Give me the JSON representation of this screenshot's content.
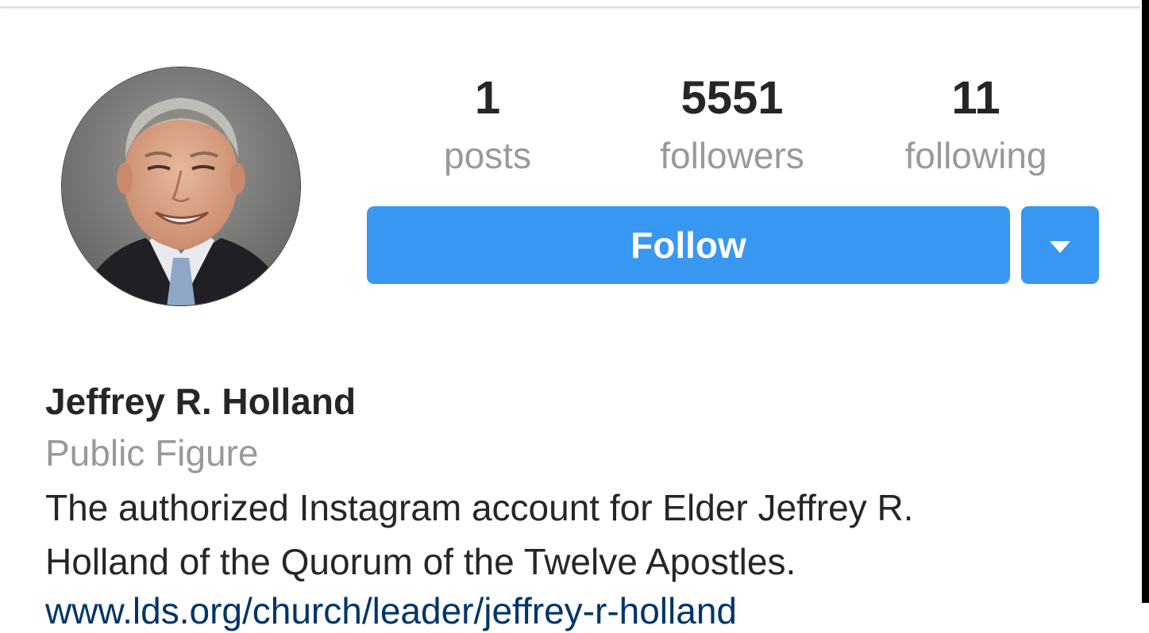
{
  "profile": {
    "posts_count": "1",
    "posts_label": "posts",
    "followers_count": "5551",
    "followers_label": "followers",
    "following_count": "11",
    "following_label": "following",
    "follow_label": "Follow",
    "name": "Jeffrey R. Holland",
    "category": "Public Figure",
    "bio_line1": "The authorized Instagram account for Elder Jeffrey R.",
    "bio_line2": "Holland of the Quorum of the Twelve Apostles.",
    "bio_link": "www.lds.org/church/leader/jeffrey-r-holland"
  },
  "colors": {
    "accent": "#3897f0",
    "text_primary": "#262626",
    "text_secondary": "#999999",
    "link": "#003569"
  },
  "icons": {
    "dropdown": "caret-down-icon"
  }
}
